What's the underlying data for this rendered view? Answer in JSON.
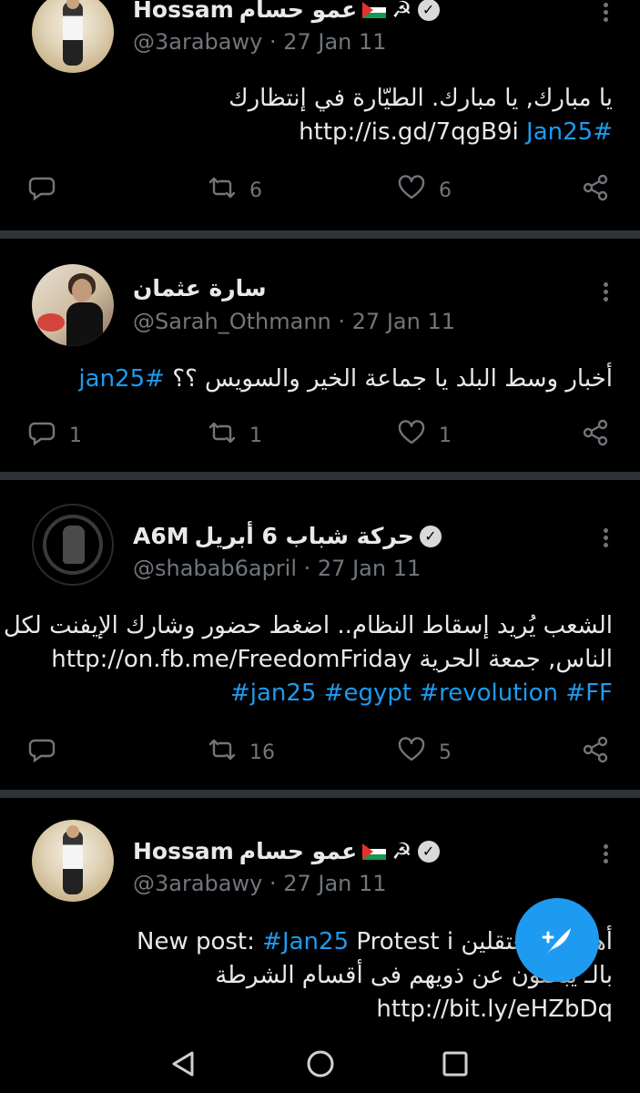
{
  "tweets": [
    {
      "name_prefix": "Hossam",
      "name_arabic": "عمو حسام",
      "name_emoji": "☭",
      "handle": "@3arabawy",
      "date": "· 27 Jan 11",
      "lines": [
        {
          "text": "يا مبارك, يا مبارك. الطيّارة في إنتظارك"
        },
        {
          "link": "http://is.gd/7qgB9i",
          "tag": "#Jan25"
        }
      ],
      "stats": {
        "replies": "",
        "retweets": "6",
        "likes": "6"
      }
    },
    {
      "name_arabic": "سارة عثمان",
      "handle": "@Sarah_Othmann",
      "date": "· 27 Jan 11",
      "lines": [
        {
          "text": "أخبار وسط البلد يا جماعة الخير والسويس ؟؟",
          "tag": "#jan25"
        }
      ],
      "stats": {
        "replies": "1",
        "retweets": "1",
        "likes": "1"
      }
    },
    {
      "name_prefix": "A6M",
      "name_arabic": "حركة شباب 6 أبريل",
      "handle": "@shabab6april",
      "date": "· 27 Jan 11",
      "lines": [
        {
          "text": "الشعب يُريد إسقاط النظام.. اضغط حضور وشارك الإيفنت لكل"
        },
        {
          "text": "الناس, جمعة الحرية",
          "link": "http://on.fb.me/FreedomFriday"
        },
        {
          "tags": "#jan25 #egypt #revolution #FF"
        }
      ],
      "stats": {
        "replies": "",
        "retweets": "16",
        "likes": "5"
      }
    },
    {
      "name_prefix": "Hossam",
      "name_arabic": "عمو حسام",
      "name_emoji": "☭",
      "handle": "@3arabawy",
      "date": "· 27 Jan 11",
      "lines": [
        {
          "text_before": "New post:",
          "tag": "#Jan25",
          "text_after": "Protest i",
          "arabic": "أهالى المعتقلين"
        },
        {
          "text": "بالـ يبحثون عن ذويهم فى أقسام الشرطة"
        },
        {
          "link": "http://bit.ly/eHZbDq"
        }
      ],
      "stats": {
        "replies": "",
        "retweets": "",
        "likes": ""
      }
    }
  ],
  "icons": {
    "reply": "reply-icon",
    "retweet": "retweet-icon",
    "like": "heart-icon",
    "share": "share-icon",
    "more": "more-vertical-icon",
    "verified": "verified-badge-icon",
    "compose": "compose-tweet-icon",
    "nav_back": "nav-back-icon",
    "nav_home": "nav-home-icon",
    "nav_recents": "nav-recents-icon"
  },
  "colors": {
    "background": "#000000",
    "text": "#e7e9ea",
    "muted": "#71767b",
    "accent": "#1d9bf0",
    "divider": "#2f3336"
  }
}
